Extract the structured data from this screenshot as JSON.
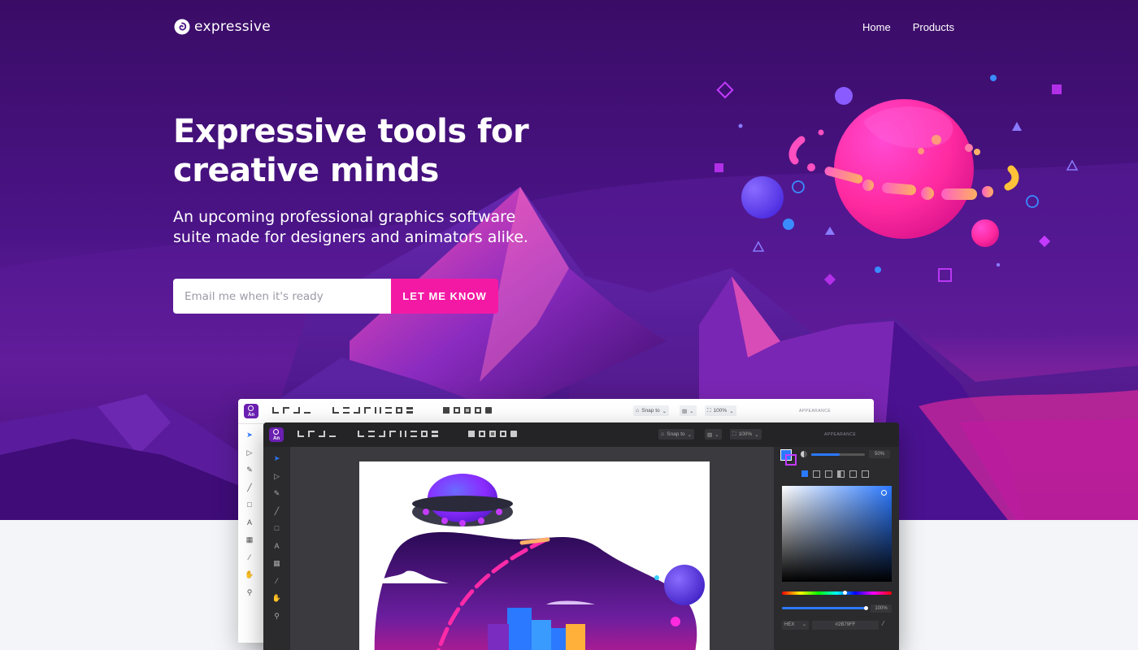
{
  "brand": {
    "name": "expressive",
    "logo_icon": "spiral-logo-icon"
  },
  "nav": {
    "items": [
      {
        "label": "Home"
      },
      {
        "label": "Products"
      }
    ]
  },
  "hero": {
    "headline_line1": "Expressive tools for",
    "headline_line2": "creative minds",
    "subhead_line1": "An upcoming professional graphics software",
    "subhead_line2": "suite made for designers and animators alike.",
    "email_placeholder": "Email me when it's ready",
    "cta_label": "LET ME KNOW"
  },
  "colors": {
    "accent": "#f419a4",
    "hero_dark": "#3a0f6b",
    "hero_mid": "#5a1a96",
    "page_bg": "#f3f5f8",
    "app_dark": "#2b2b2e",
    "selection_blue": "#2b79ff"
  },
  "app_back": {
    "icon_label": "An",
    "snap_label": "Snap to",
    "zoom_label": "100%",
    "panel_title": "APPEARANCE"
  },
  "app_front": {
    "icon_label": "An",
    "snap_label": "Snap to",
    "zoom_label": "100%",
    "panel_title": "APPEARANCE",
    "opacity_value": "50%",
    "alpha_value": "100%",
    "color_mode": "HEX",
    "hex_value": "#2B79FF"
  }
}
